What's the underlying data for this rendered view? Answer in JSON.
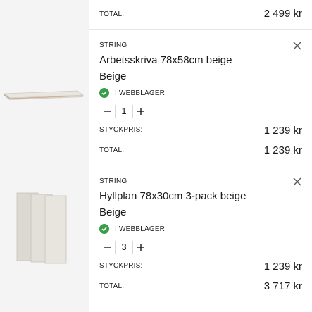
{
  "top_summary": {
    "label": "TOTAL:",
    "amount": "2 499 kr"
  },
  "items": [
    {
      "brand": "STRING",
      "name": "Arbetsskriva 78x58cm beige",
      "color": "Beige",
      "stock_status": "I WEBBLAGER",
      "quantity": "1",
      "unit_price_label": "STYCKPRIS:",
      "unit_price": "1 239 kr",
      "total_label": "TOTAL:",
      "total": "1 239 kr"
    },
    {
      "brand": "STRING",
      "name": "Hyllplan 78x30cm 3-pack beige",
      "color": "Beige",
      "stock_status": "I WEBBLAGER",
      "quantity": "3",
      "unit_price_label": "STYCKPRIS:",
      "unit_price": "1 239 kr",
      "total_label": "TOTAL:",
      "total": "3 717 kr"
    }
  ],
  "icons": {
    "remove": "close-icon",
    "stock": "check-circle-icon",
    "decrease": "minus-icon",
    "increase": "plus-icon"
  },
  "colors": {
    "in_stock": "#3a9d4a",
    "thumb_bg": "#f4f4f4",
    "divider": "#e6e6e6"
  }
}
